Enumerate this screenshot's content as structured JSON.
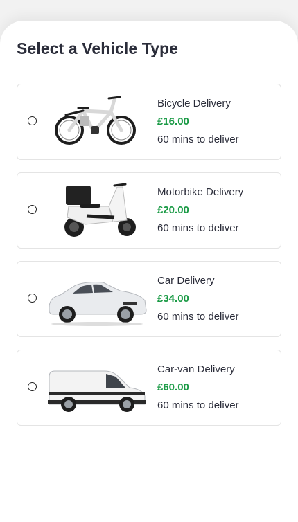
{
  "page": {
    "title": "Select a Vehicle Type"
  },
  "colors": {
    "price": "#1a9a45",
    "text": "#2b2d3a",
    "border": "#e4e4e4"
  },
  "vehicles": [
    {
      "name": "Bicycle Delivery",
      "price": "£16.00",
      "eta": "60 mins to deliver",
      "icon": "bicycle-image",
      "selected": false
    },
    {
      "name": "Motorbike Delivery",
      "price": "£20.00",
      "eta": "60 mins to deliver",
      "icon": "scooter-image",
      "selected": false
    },
    {
      "name": "Car Delivery",
      "price": "£34.00",
      "eta": "60 mins to deliver",
      "icon": "car-image",
      "selected": false
    },
    {
      "name": "Car-van Delivery",
      "price": "£60.00",
      "eta": "60 mins to deliver",
      "icon": "van-image",
      "selected": false
    }
  ]
}
